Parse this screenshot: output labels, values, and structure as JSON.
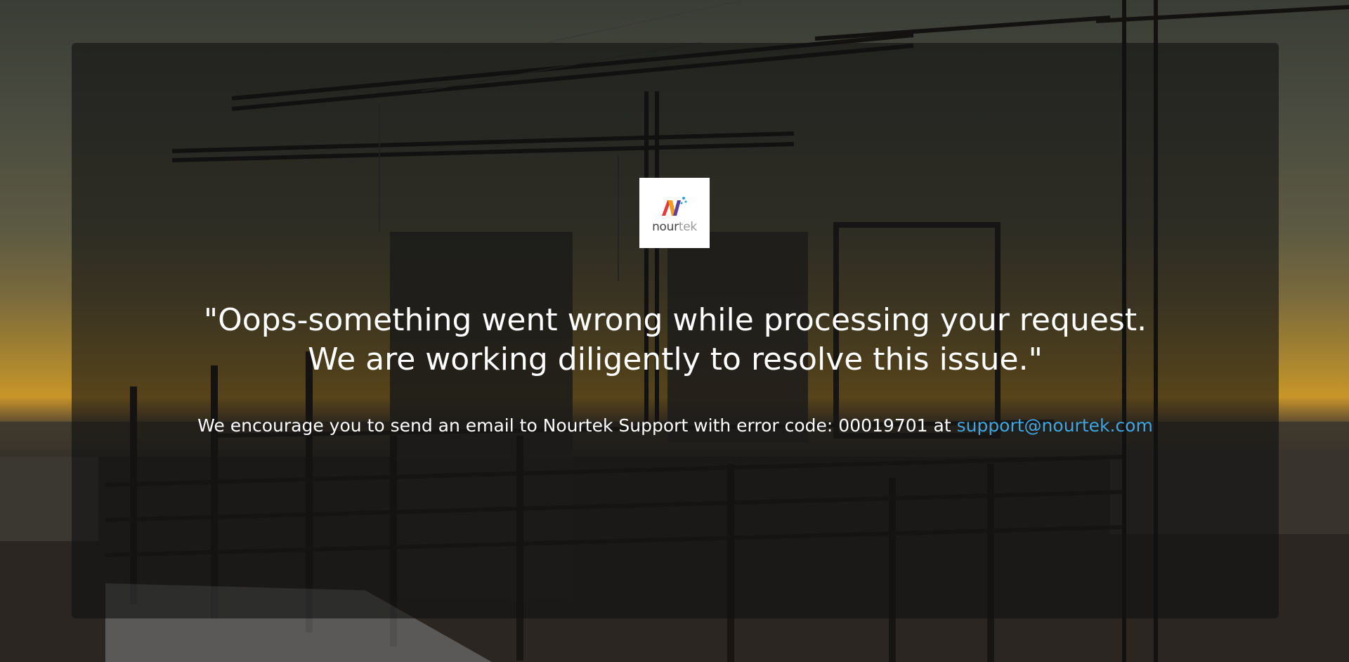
{
  "logo": {
    "brand_dark": "nour",
    "brand_light": "tek",
    "colors": [
      "#e23b3b",
      "#f29b1d",
      "#5b3fa0",
      "#2aa6df"
    ]
  },
  "message": {
    "line1": "\"Oops-something went wrong while processing your request.",
    "line2": "We are working diligently to resolve this issue.\""
  },
  "support": {
    "text": "We encourage you to send an email to Nourtek Support with error code: 00019701 at ",
    "email": "support@nourtek.com"
  },
  "colors": {
    "link": "#3fa6e0",
    "text": "#ffffff"
  }
}
